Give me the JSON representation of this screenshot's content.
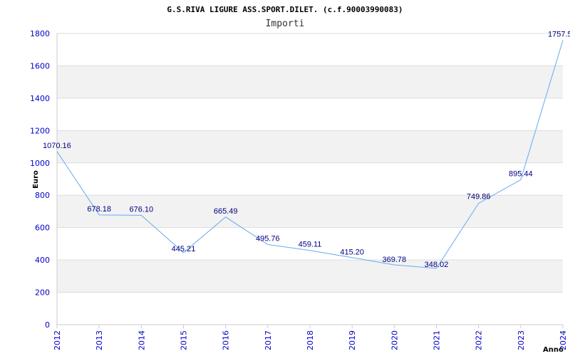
{
  "chart_data": {
    "type": "line",
    "title": "G.S.RIVA LIGURE ASS.SPORT.DILET. (c.f.90003990083)",
    "subtitle": "Importi",
    "xlabel": "Anno",
    "ylabel": "Euro",
    "ylim": [
      0,
      1800
    ],
    "yticks": [
      0,
      200,
      400,
      600,
      800,
      1000,
      1200,
      1400,
      1600,
      1800
    ],
    "grid": "horizontal alternating bands",
    "colors": {
      "line": "#66aaee",
      "band": "#f2f2f2",
      "tick_text": "#0000cc",
      "data_label": "#000080"
    },
    "series": [
      {
        "x": [
          "2012",
          "2013",
          "2014",
          "2015",
          "2016",
          "2017",
          "2018",
          "2019",
          "2020",
          "2021",
          "2022",
          "2023",
          "2024"
        ],
        "values": [
          1070.16,
          678.18,
          676.1,
          445.21,
          665.49,
          495.76,
          459.11,
          415.2,
          369.78,
          348.02,
          749.86,
          895.44,
          1757.5
        ],
        "labels": [
          "1070.16",
          "678.18",
          "676.10",
          "445.21",
          "665.49",
          "495.76",
          "459.11",
          "415.20",
          "369.78",
          "348.02",
          "749.86",
          "895.44",
          "1757.5"
        ]
      }
    ]
  }
}
